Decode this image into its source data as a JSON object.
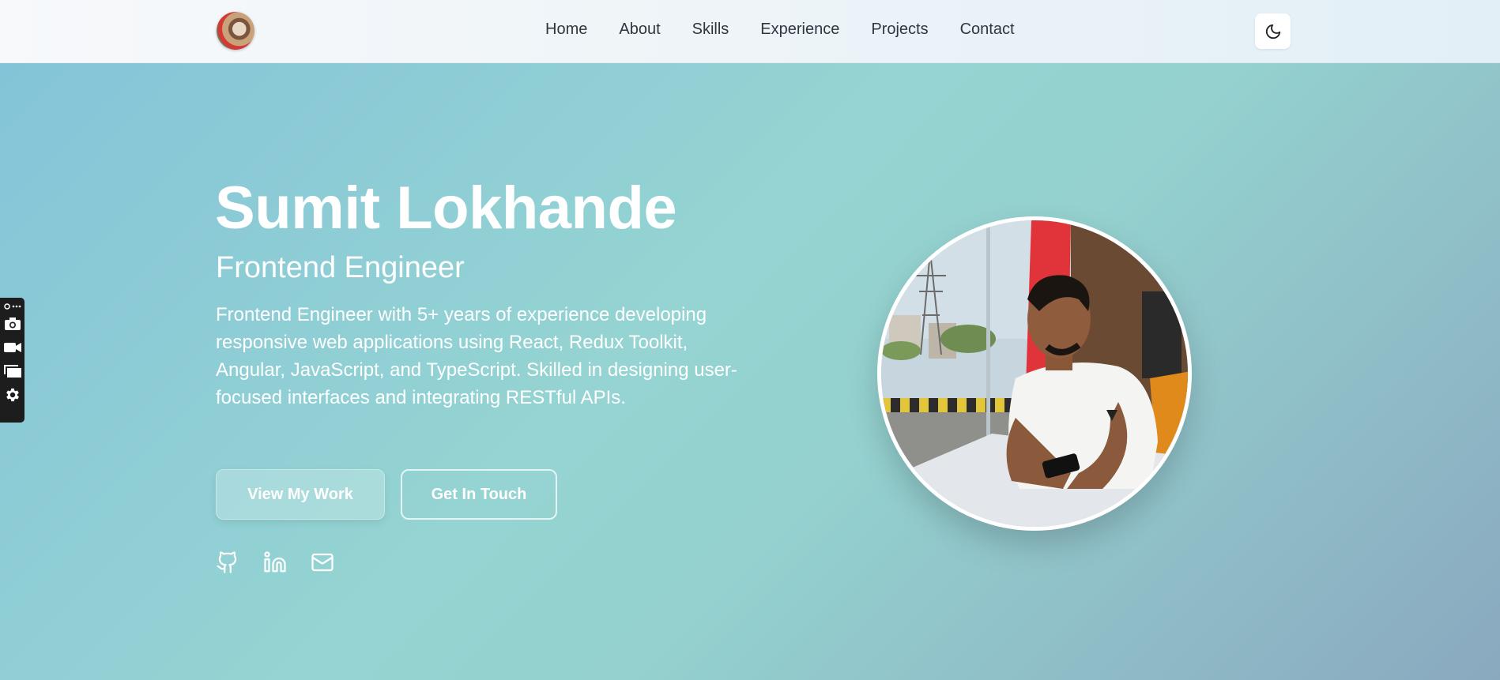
{
  "nav": {
    "links": [
      "Home",
      "About",
      "Skills",
      "Experience",
      "Projects",
      "Contact"
    ]
  },
  "hero": {
    "name": "Sumit Lokhande",
    "role": "Frontend Engineer",
    "description": "Frontend Engineer with 5+ years of experience developing responsive web applications using React, Redux Toolkit, Angular, JavaScript, and TypeScript. Skilled in designing user-focused interfaces and integrating RESTful APIs.",
    "primary_button": "View My Work",
    "secondary_button": "Get In Touch",
    "socials": [
      "github-icon",
      "linkedin-icon",
      "mail-icon"
    ]
  },
  "theme": {
    "toggle_icon": "moon-icon"
  },
  "toolbar": {
    "tools": [
      "brush-more-icon",
      "camera-icon",
      "video-icon",
      "screens-icon",
      "gear-icon"
    ]
  },
  "colors": {
    "nav_text": "#2f3640",
    "hero_text": "#ffffff",
    "background_start": "#83c3d9",
    "background_end": "#8aa9bf"
  }
}
